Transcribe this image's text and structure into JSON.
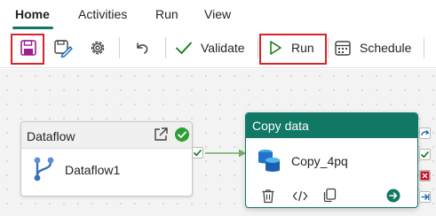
{
  "tabs": [
    {
      "label": "Home",
      "active": true
    },
    {
      "label": "Activities",
      "active": false
    },
    {
      "label": "Run",
      "active": false
    },
    {
      "label": "View",
      "active": false
    }
  ],
  "toolbar": {
    "save_icon": "save-icon",
    "save_as_icon": "save-as-icon",
    "settings_icon": "gear-icon",
    "undo_icon": "undo-icon",
    "validate_label": "Validate",
    "run_label": "Run",
    "schedule_label": "Schedule"
  },
  "canvas": {
    "dataflow_card": {
      "title": "Dataflow",
      "name": "Dataflow1",
      "status": "succeeded"
    },
    "copy_card": {
      "title": "Copy data",
      "name": "Copy_4pq"
    }
  },
  "colors": {
    "accent": "#117865",
    "highlight": "#d8232a",
    "success": "#107c10",
    "failure": "#c50f1f",
    "skip": "#0f6cbd"
  }
}
